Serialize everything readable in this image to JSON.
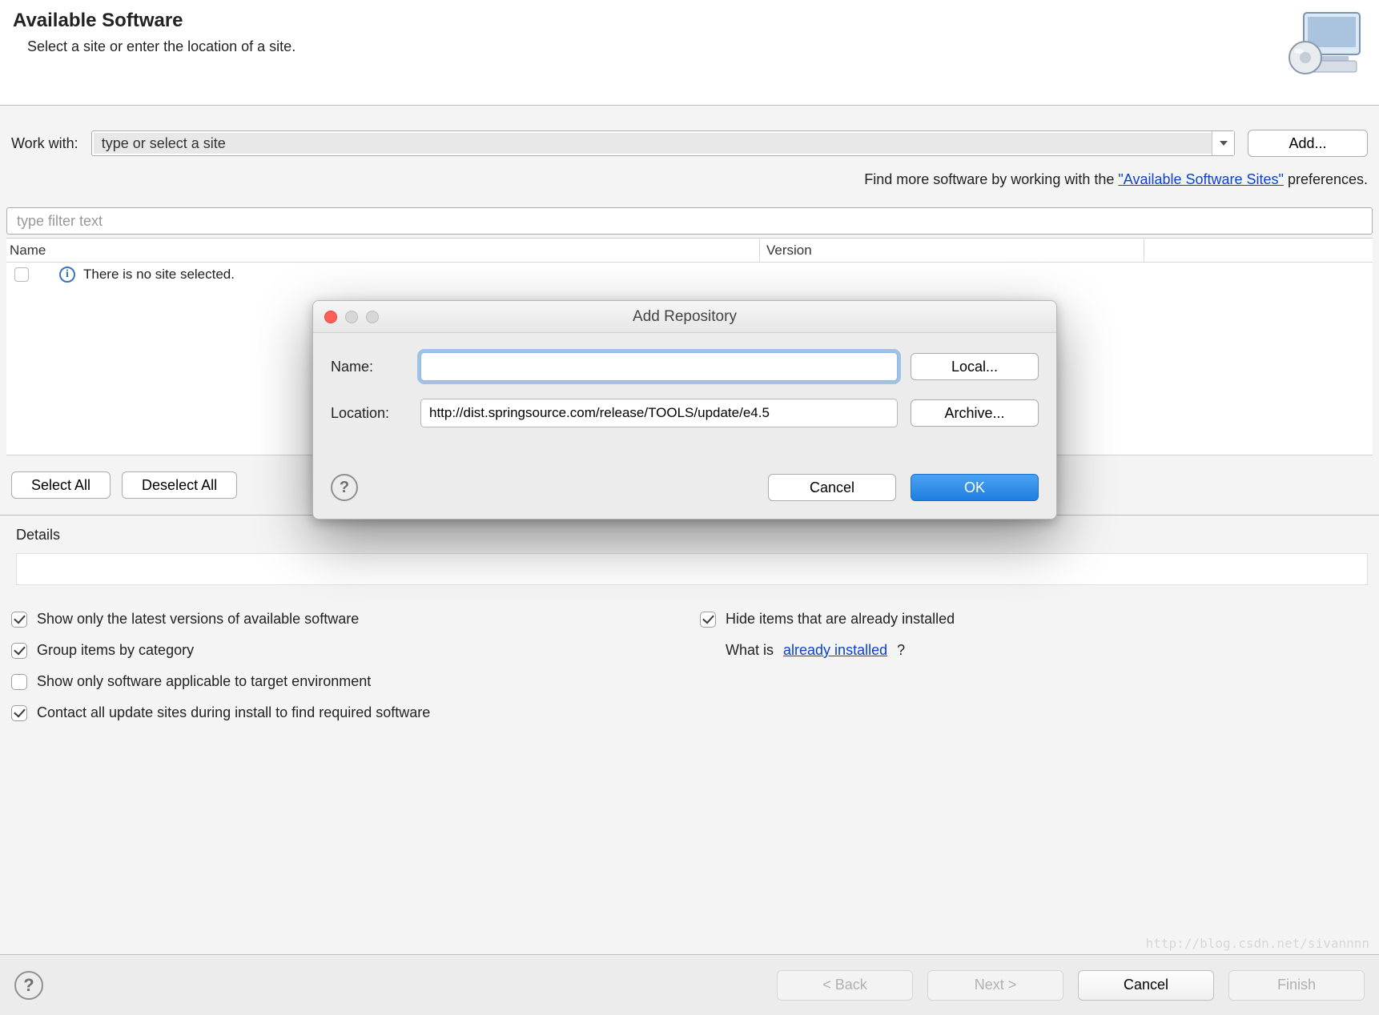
{
  "banner": {
    "title": "Available Software",
    "subtitle": "Select a site or enter the location of a site."
  },
  "workwith": {
    "label": "Work with:",
    "combo_text": "type or select a site",
    "add_label": "Add..."
  },
  "find_more": {
    "prefix": "Find more software by working with the ",
    "link": "\"Available Software Sites\"",
    "suffix": " preferences."
  },
  "filter": {
    "placeholder": "type filter text"
  },
  "table": {
    "col_name": "Name",
    "col_version": "Version",
    "empty_message": "There is no site selected."
  },
  "buttons": {
    "select_all": "Select All",
    "deselect_all": "Deselect All"
  },
  "details": {
    "label": "Details"
  },
  "options": {
    "show_latest": {
      "checked": true,
      "label": "Show only the latest versions of available software"
    },
    "hide_installed": {
      "checked": true,
      "label": "Hide items that are already installed"
    },
    "group_category": {
      "checked": true,
      "label": "Group items by category"
    },
    "already_prefix": "What is ",
    "already_link": "already installed",
    "already_suffix": "?",
    "target_env": {
      "checked": false,
      "label": "Show only software applicable to target environment"
    },
    "contact_sites": {
      "checked": true,
      "label": "Contact all update sites during install to find required software"
    }
  },
  "wizard": {
    "back": "< Back",
    "next": "Next >",
    "cancel": "Cancel",
    "finish": "Finish"
  },
  "modal": {
    "title": "Add Repository",
    "name_label": "Name:",
    "name_value": "",
    "location_label": "Location:",
    "location_value": "http://dist.springsource.com/release/TOOLS/update/e4.5",
    "local_btn": "Local...",
    "archive_btn": "Archive...",
    "cancel": "Cancel",
    "ok": "OK"
  },
  "watermark": "http://blog.csdn.net/sivannnn"
}
